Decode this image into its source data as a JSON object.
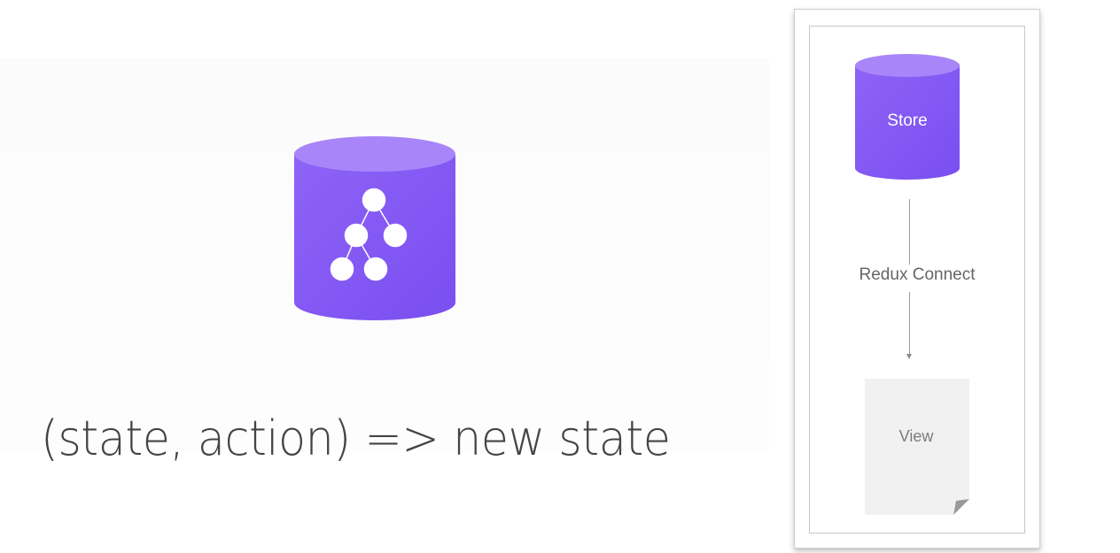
{
  "slide": {
    "formula": "(state, action) => new state"
  },
  "diagram": {
    "store_label": "Store",
    "connector_label": "Redux Connect",
    "view_label": "View"
  },
  "colors": {
    "cylinder_body": "#8a5cf6",
    "cylinder_top": "#a37ff8",
    "text_dark": "#444444",
    "view_paper": "#f2f2f2"
  }
}
